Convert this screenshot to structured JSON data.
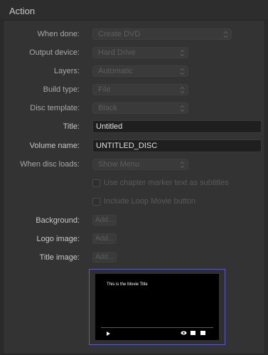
{
  "header": {
    "title": "Action"
  },
  "rows": {
    "when_done": {
      "label": "When done:",
      "value": "Create DVD"
    },
    "output_device": {
      "label": "Output device:",
      "value": "Hard Drive"
    },
    "layers": {
      "label": "Layers:",
      "value": "Automatic"
    },
    "build_type": {
      "label": "Build type:",
      "value": "File"
    },
    "disc_template": {
      "label": "Disc template:",
      "value": "Black"
    },
    "title": {
      "label": "Title:",
      "value": "Untitled"
    },
    "volume_name": {
      "label": "Volume name:",
      "value": "UNTITLED_DISC"
    },
    "when_disc_loads": {
      "label": "When disc loads:",
      "value": "Show Menu"
    }
  },
  "checkboxes": {
    "chapter_markers": {
      "label": "Use chapter marker text as subtitles",
      "checked": false
    },
    "loop_movie": {
      "label": "Include Loop Movie button",
      "checked": false
    }
  },
  "images": {
    "background": {
      "label": "Background:",
      "button": "Add..."
    },
    "logo": {
      "label": "Logo image:",
      "button": "Add..."
    },
    "title_image": {
      "label": "Title image:",
      "button": "Add..."
    }
  },
  "preview": {
    "movie_title": "This is the Movie Title"
  },
  "colors": {
    "panel": "#333333",
    "accent": "#5a5ac8",
    "field": "#1f1f1f"
  },
  "icons": [
    "chevron-updown-icon",
    "play-icon",
    "eye-icon",
    "subtitles-icon",
    "chapters-icon"
  ]
}
